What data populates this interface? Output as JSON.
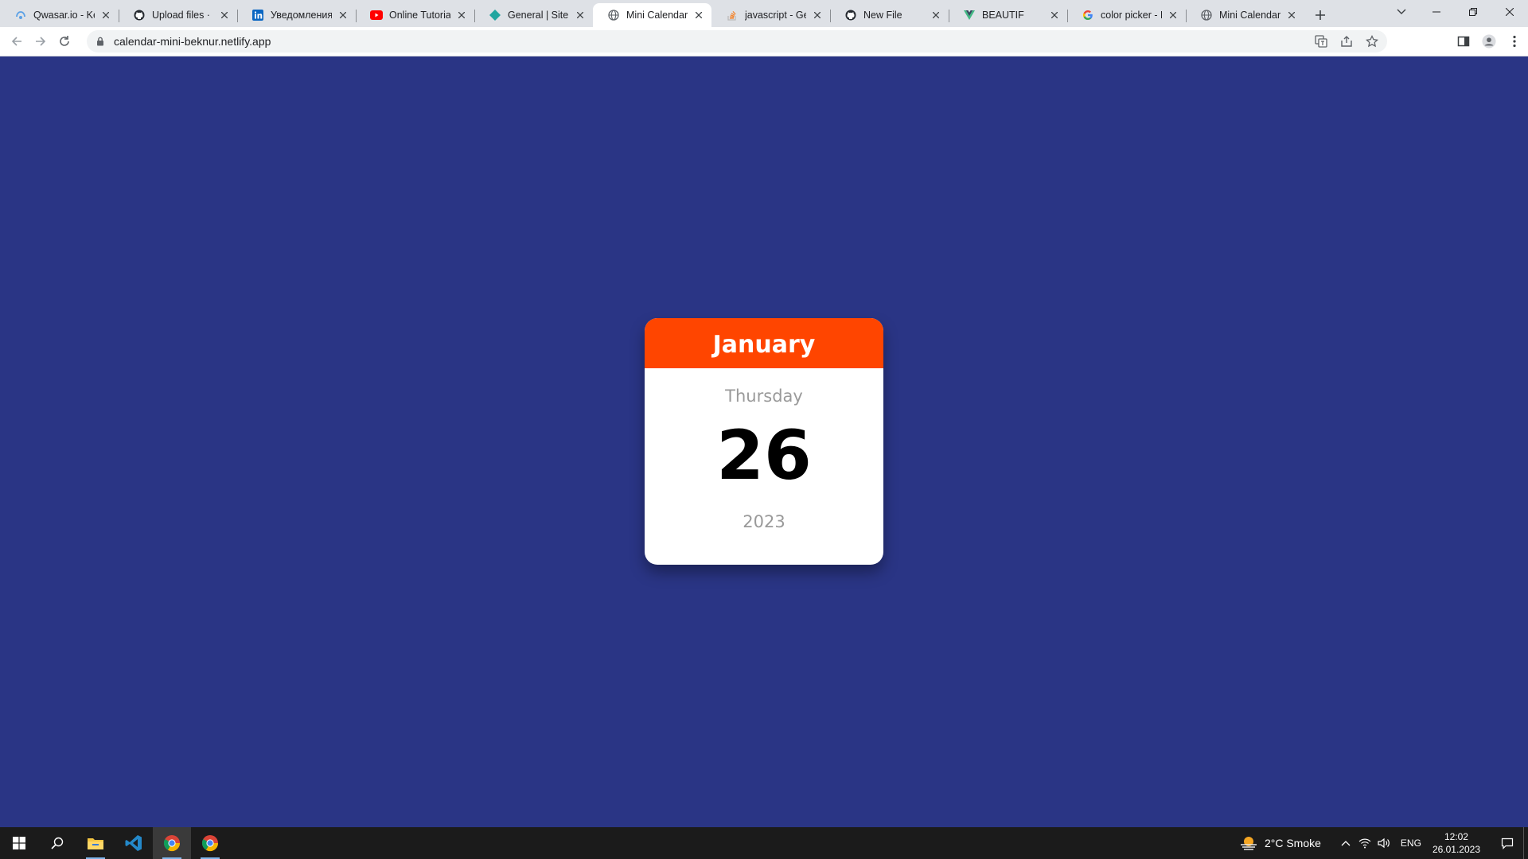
{
  "browser": {
    "tabs": [
      {
        "title": "Qwasar.io - Kee",
        "icon": "qwasar-icon"
      },
      {
        "title": "Upload files · be",
        "icon": "github-icon"
      },
      {
        "title": "Уведомления |",
        "icon": "linkedin-icon"
      },
      {
        "title": "Online Tutorials",
        "icon": "youtube-icon"
      },
      {
        "title": "General | Site se",
        "icon": "netlify-icon"
      },
      {
        "title": "Mini Calendar",
        "icon": "globe-icon",
        "active": true
      },
      {
        "title": "javascript - Gett",
        "icon": "stackoverflow-icon"
      },
      {
        "title": "New File",
        "icon": "github-icon"
      },
      {
        "title": "BEAUTIF",
        "icon": "vue-icon"
      },
      {
        "title": "color picker - П",
        "icon": "google-icon"
      },
      {
        "title": "Mini Calendar",
        "icon": "globe-icon"
      }
    ],
    "url": "calendar-mini-beknur.netlify.app"
  },
  "calendar": {
    "month": "January",
    "day_name": "Thursday",
    "day_number": "26",
    "year": "2023"
  },
  "taskbar": {
    "weather": "2°C  Smoke",
    "language": "ENG",
    "time": "12:02",
    "date": "26.01.2023"
  },
  "colors": {
    "page_background": "#2a3585",
    "calendar_header": "#ff4500",
    "calendar_body": "#ffffff",
    "muted_text": "#9a9a9a"
  }
}
